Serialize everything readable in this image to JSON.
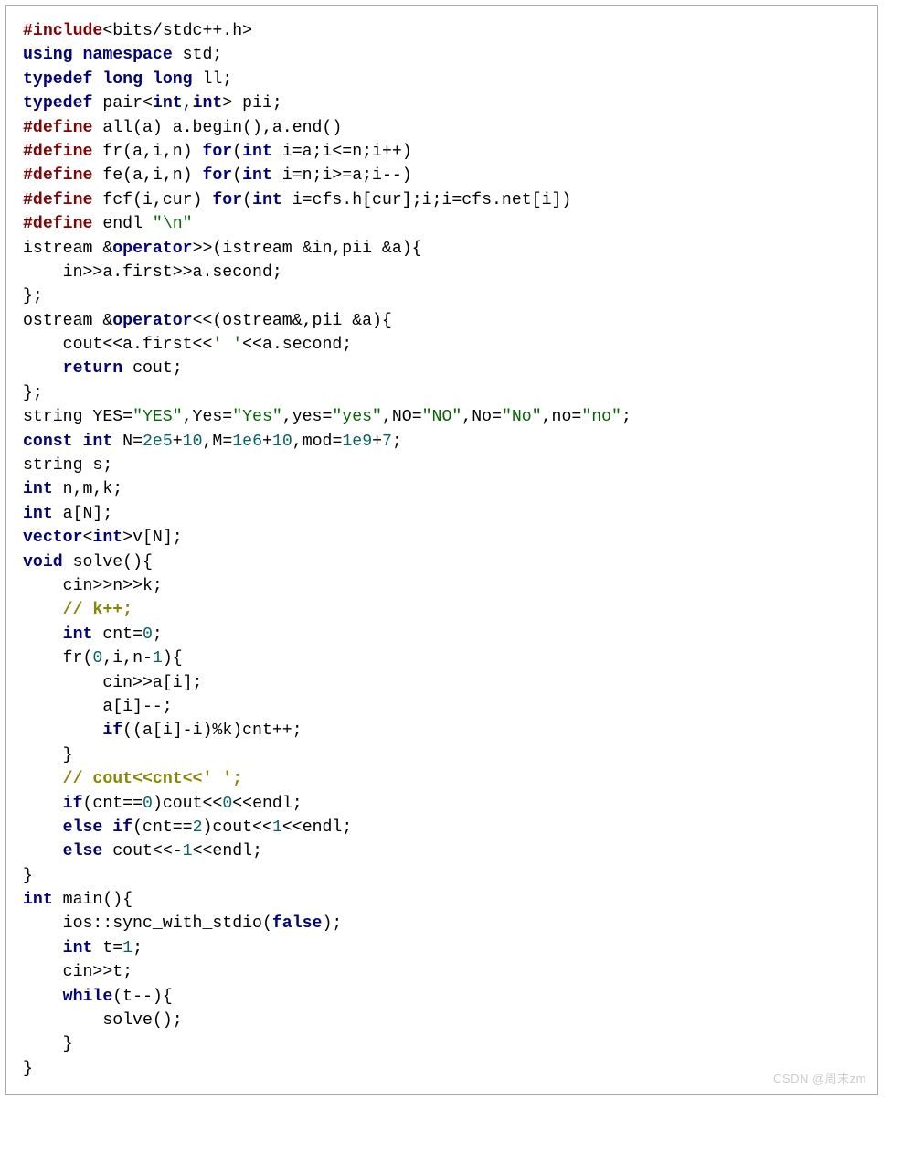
{
  "watermark": "CSDN @周末zm",
  "code": {
    "lines": [
      [
        [
          "pp",
          "#include"
        ],
        [
          "plain",
          "<bits/stdc++.h>"
        ]
      ],
      [
        [
          "kw",
          "using"
        ],
        [
          "plain",
          " "
        ],
        [
          "kw",
          "namespace"
        ],
        [
          "plain",
          " std;"
        ]
      ],
      [
        [
          "kw",
          "typedef"
        ],
        [
          "plain",
          " "
        ],
        [
          "kw",
          "long"
        ],
        [
          "plain",
          " "
        ],
        [
          "kw",
          "long"
        ],
        [
          "plain",
          " ll;"
        ]
      ],
      [
        [
          "kw",
          "typedef"
        ],
        [
          "plain",
          " pair<"
        ],
        [
          "kw",
          "int"
        ],
        [
          "plain",
          ","
        ],
        [
          "kw",
          "int"
        ],
        [
          "plain",
          "> pii;"
        ]
      ],
      [
        [
          "pp",
          "#define"
        ],
        [
          "plain",
          " all(a) a.begin(),a.end()"
        ]
      ],
      [
        [
          "pp",
          "#define"
        ],
        [
          "plain",
          " fr(a,i,n) "
        ],
        [
          "kw",
          "for"
        ],
        [
          "plain",
          "("
        ],
        [
          "kw",
          "int"
        ],
        [
          "plain",
          " i=a;i<=n;i++)"
        ]
      ],
      [
        [
          "pp",
          "#define"
        ],
        [
          "plain",
          " fe(a,i,n) "
        ],
        [
          "kw",
          "for"
        ],
        [
          "plain",
          "("
        ],
        [
          "kw",
          "int"
        ],
        [
          "plain",
          " i=n;i>=a;i--)"
        ]
      ],
      [
        [
          "pp",
          "#define"
        ],
        [
          "plain",
          " fcf(i,cur) "
        ],
        [
          "kw",
          "for"
        ],
        [
          "plain",
          "("
        ],
        [
          "kw",
          "int"
        ],
        [
          "plain",
          " i=cfs.h[cur];i;i=cfs.net[i])"
        ]
      ],
      [
        [
          "pp",
          "#define"
        ],
        [
          "plain",
          " endl "
        ],
        [
          "str",
          "\"\\n\""
        ]
      ],
      [
        [
          "plain",
          "istream &"
        ],
        [
          "kw",
          "operator"
        ],
        [
          "plain",
          ">>(istream &in,pii &a){"
        ]
      ],
      [
        [
          "plain",
          "    in>>a.first>>a.second;"
        ]
      ],
      [
        [
          "plain",
          "};"
        ]
      ],
      [
        [
          "plain",
          "ostream &"
        ],
        [
          "kw",
          "operator"
        ],
        [
          "plain",
          "<<(ostream&,pii &a){"
        ]
      ],
      [
        [
          "plain",
          "    cout<<a.first<<"
        ],
        [
          "str",
          "' '"
        ],
        [
          "plain",
          "<<a.second;"
        ]
      ],
      [
        [
          "plain",
          "    "
        ],
        [
          "kw",
          "return"
        ],
        [
          "plain",
          " cout;"
        ]
      ],
      [
        [
          "plain",
          "};"
        ]
      ],
      [
        [
          "plain",
          "string YES="
        ],
        [
          "str",
          "\"YES\""
        ],
        [
          "plain",
          ",Yes="
        ],
        [
          "str",
          "\"Yes\""
        ],
        [
          "plain",
          ",yes="
        ],
        [
          "str",
          "\"yes\""
        ],
        [
          "plain",
          ",NO="
        ],
        [
          "str",
          "\"NO\""
        ],
        [
          "plain",
          ",No="
        ],
        [
          "str",
          "\"No\""
        ],
        [
          "plain",
          ",no="
        ],
        [
          "str",
          "\"no\""
        ],
        [
          "plain",
          ";"
        ]
      ],
      [
        [
          "kw",
          "const"
        ],
        [
          "plain",
          " "
        ],
        [
          "kw",
          "int"
        ],
        [
          "plain",
          " N="
        ],
        [
          "num",
          "2e5"
        ],
        [
          "plain",
          "+"
        ],
        [
          "num",
          "10"
        ],
        [
          "plain",
          ",M="
        ],
        [
          "num",
          "1e6"
        ],
        [
          "plain",
          "+"
        ],
        [
          "num",
          "10"
        ],
        [
          "plain",
          ",mod="
        ],
        [
          "num",
          "1e9"
        ],
        [
          "plain",
          "+"
        ],
        [
          "num",
          "7"
        ],
        [
          "plain",
          ";"
        ]
      ],
      [
        [
          "plain",
          "string s;"
        ]
      ],
      [
        [
          "kw",
          "int"
        ],
        [
          "plain",
          " n,m,k;"
        ]
      ],
      [
        [
          "kw",
          "int"
        ],
        [
          "plain",
          " a[N];"
        ]
      ],
      [
        [
          "kw",
          "vector"
        ],
        [
          "plain",
          "<"
        ],
        [
          "kw",
          "int"
        ],
        [
          "plain",
          ">v[N];"
        ]
      ],
      [
        [
          "kw",
          "void"
        ],
        [
          "plain",
          " solve(){"
        ]
      ],
      [
        [
          "plain",
          "    cin>>n>>k;"
        ]
      ],
      [
        [
          "plain",
          "    "
        ],
        [
          "com",
          "// k++;"
        ]
      ],
      [
        [
          "plain",
          "    "
        ],
        [
          "kw",
          "int"
        ],
        [
          "plain",
          " cnt="
        ],
        [
          "num",
          "0"
        ],
        [
          "plain",
          ";"
        ]
      ],
      [
        [
          "plain",
          "    fr("
        ],
        [
          "num",
          "0"
        ],
        [
          "plain",
          ",i,n-"
        ],
        [
          "num",
          "1"
        ],
        [
          "plain",
          "){"
        ]
      ],
      [
        [
          "plain",
          "        cin>>a[i];"
        ]
      ],
      [
        [
          "plain",
          "        a[i]--;"
        ]
      ],
      [
        [
          "plain",
          "        "
        ],
        [
          "kw",
          "if"
        ],
        [
          "plain",
          "((a[i]-i)%k)cnt++;"
        ]
      ],
      [
        [
          "plain",
          "    }"
        ]
      ],
      [
        [
          "plain",
          "    "
        ],
        [
          "com",
          "// cout<<cnt<<' ';"
        ]
      ],
      [
        [
          "plain",
          "    "
        ],
        [
          "kw",
          "if"
        ],
        [
          "plain",
          "(cnt=="
        ],
        [
          "num",
          "0"
        ],
        [
          "plain",
          ")cout<<"
        ],
        [
          "num",
          "0"
        ],
        [
          "plain",
          "<<endl;"
        ]
      ],
      [
        [
          "plain",
          "    "
        ],
        [
          "kw",
          "else"
        ],
        [
          "plain",
          " "
        ],
        [
          "kw",
          "if"
        ],
        [
          "plain",
          "(cnt=="
        ],
        [
          "num",
          "2"
        ],
        [
          "plain",
          ")cout<<"
        ],
        [
          "num",
          "1"
        ],
        [
          "plain",
          "<<endl;"
        ]
      ],
      [
        [
          "plain",
          "    "
        ],
        [
          "kw",
          "else"
        ],
        [
          "plain",
          " cout<<-"
        ],
        [
          "num",
          "1"
        ],
        [
          "plain",
          "<<endl;"
        ]
      ],
      [
        [
          "plain",
          "}"
        ]
      ],
      [
        [
          "kw",
          "int"
        ],
        [
          "plain",
          " main(){"
        ]
      ],
      [
        [
          "plain",
          "    ios::sync_with_stdio("
        ],
        [
          "kw",
          "false"
        ],
        [
          "plain",
          ");"
        ]
      ],
      [
        [
          "plain",
          "    "
        ],
        [
          "kw",
          "int"
        ],
        [
          "plain",
          " t="
        ],
        [
          "num",
          "1"
        ],
        [
          "plain",
          ";"
        ]
      ],
      [
        [
          "plain",
          "    cin>>t;"
        ]
      ],
      [
        [
          "plain",
          "    "
        ],
        [
          "kw",
          "while"
        ],
        [
          "plain",
          "(t--){"
        ]
      ],
      [
        [
          "plain",
          "        solve();"
        ]
      ],
      [
        [
          "plain",
          "    }"
        ]
      ],
      [
        [
          "plain",
          "}"
        ]
      ]
    ]
  }
}
